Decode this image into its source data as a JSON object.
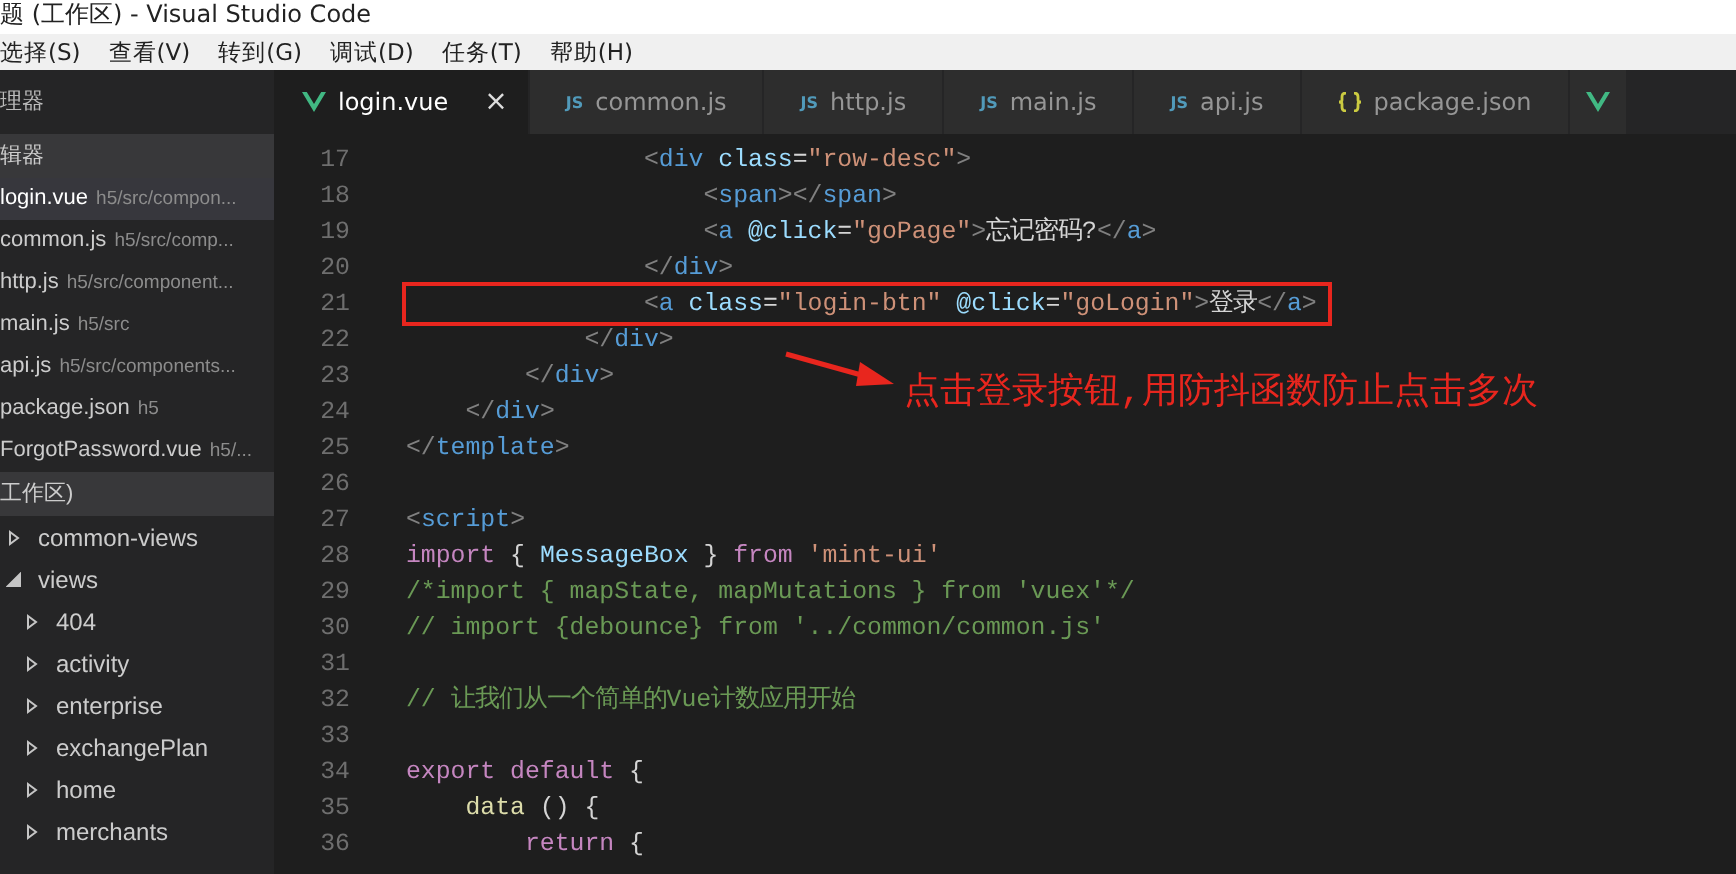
{
  "window": {
    "title": "题 (工作区) - Visual Studio Code"
  },
  "menu": [
    "选择(S)",
    "查看(V)",
    "转到(G)",
    "调试(D)",
    "任务(T)",
    "帮助(H)"
  ],
  "sidebar": {
    "title": "理器",
    "open_editors": {
      "title": "辑器",
      "items": [
        {
          "name": "login.vue",
          "path": "h5/src/compon...",
          "selected": true
        },
        {
          "name": "common.js",
          "path": "h5/src/comp...",
          "selected": false
        },
        {
          "name": "http.js",
          "path": "h5/src/component...",
          "selected": false
        },
        {
          "name": "main.js",
          "path": "h5/src",
          "selected": false
        },
        {
          "name": "api.js",
          "path": "h5/src/components...",
          "selected": false
        },
        {
          "name": "package.json",
          "path": "h5",
          "selected": false
        },
        {
          "name": "ForgotPassword.vue",
          "path": "h5/...",
          "selected": false
        }
      ]
    },
    "workspace": {
      "title": "工作区)",
      "items": [
        {
          "name": "common-views",
          "expanded": false
        },
        {
          "name": "views",
          "expanded": true,
          "children": [
            {
              "name": "404",
              "expanded": false
            },
            {
              "name": "activity",
              "expanded": false
            },
            {
              "name": "enterprise",
              "expanded": false
            },
            {
              "name": "exchangePlan",
              "expanded": false
            },
            {
              "name": "home",
              "expanded": false
            },
            {
              "name": "merchants",
              "expanded": false
            }
          ]
        }
      ]
    }
  },
  "tabs": [
    {
      "label": "login.vue",
      "kind": "vue",
      "selected": true,
      "close": "×"
    },
    {
      "label": "common.js",
      "kind": "js",
      "badge": "JS",
      "selected": false
    },
    {
      "label": "http.js",
      "kind": "js",
      "badge": "JS",
      "selected": false
    },
    {
      "label": "main.js",
      "kind": "js",
      "badge": "JS",
      "selected": false
    },
    {
      "label": "api.js",
      "kind": "js",
      "badge": "JS",
      "selected": false
    },
    {
      "label": "package.json",
      "kind": "json",
      "selected": false
    },
    {
      "kind": "vue",
      "selected": false
    }
  ],
  "code": [
    {
      "number": "17",
      "highlighted": false,
      "tokens": [
        {
          "kind": "punct",
          "text": "                <"
        },
        {
          "kind": "tag",
          "text": "div"
        },
        {
          "kind": "attr",
          "text": " class"
        },
        {
          "kind": "text",
          "text": "="
        },
        {
          "kind": "string",
          "text": "\"row-desc\""
        },
        {
          "kind": "punct",
          "text": ">"
        }
      ]
    },
    {
      "number": "18",
      "highlighted": false,
      "tokens": [
        {
          "kind": "punct",
          "text": "                    <"
        },
        {
          "kind": "tag",
          "text": "span"
        },
        {
          "kind": "punct",
          "text": "></"
        },
        {
          "kind": "tag",
          "text": "span"
        },
        {
          "kind": "punct",
          "text": ">"
        }
      ]
    },
    {
      "number": "19",
      "highlighted": false,
      "tokens": [
        {
          "kind": "punct",
          "text": "                    <"
        },
        {
          "kind": "tag",
          "text": "a"
        },
        {
          "kind": "attr",
          "text": " @click"
        },
        {
          "kind": "text",
          "text": "="
        },
        {
          "kind": "string",
          "text": "\"goPage\""
        },
        {
          "kind": "punct",
          "text": ">"
        },
        {
          "kind": "text",
          "text": "忘记密码?"
        },
        {
          "kind": "punct",
          "text": "</"
        },
        {
          "kind": "tag",
          "text": "a"
        },
        {
          "kind": "punct",
          "text": ">"
        }
      ]
    },
    {
      "number": "20",
      "highlighted": false,
      "tokens": [
        {
          "kind": "punct",
          "text": "                </"
        },
        {
          "kind": "tag",
          "text": "div"
        },
        {
          "kind": "punct",
          "text": ">"
        }
      ]
    },
    {
      "number": "21",
      "highlighted": true,
      "tokens": [
        {
          "kind": "punct",
          "text": "                <"
        },
        {
          "kind": "tag",
          "text": "a"
        },
        {
          "kind": "attr",
          "text": " class"
        },
        {
          "kind": "text",
          "text": "="
        },
        {
          "kind": "string",
          "text": "\"login-btn\""
        },
        {
          "kind": "attr",
          "text": " @click"
        },
        {
          "kind": "text",
          "text": "="
        },
        {
          "kind": "string",
          "text": "\"goLogin\""
        },
        {
          "kind": "punct",
          "text": ">"
        },
        {
          "kind": "text",
          "text": "登录"
        },
        {
          "kind": "punct",
          "text": "</"
        },
        {
          "kind": "tag",
          "text": "a"
        },
        {
          "kind": "punct",
          "text": ">"
        }
      ]
    },
    {
      "number": "22",
      "highlighted": false,
      "tokens": [
        {
          "kind": "punct",
          "text": "            </"
        },
        {
          "kind": "tag",
          "text": "div"
        },
        {
          "kind": "punct",
          "text": ">"
        }
      ]
    },
    {
      "number": "23",
      "highlighted": false,
      "tokens": [
        {
          "kind": "punct",
          "text": "        </"
        },
        {
          "kind": "tag",
          "text": "div"
        },
        {
          "kind": "punct",
          "text": ">"
        }
      ]
    },
    {
      "number": "24",
      "highlighted": false,
      "tokens": [
        {
          "kind": "punct",
          "text": "    </"
        },
        {
          "kind": "tag",
          "text": "div"
        },
        {
          "kind": "punct",
          "text": ">"
        }
      ]
    },
    {
      "number": "25",
      "highlighted": false,
      "tokens": [
        {
          "kind": "punct",
          "text": "</"
        },
        {
          "kind": "tag",
          "text": "template"
        },
        {
          "kind": "punct",
          "text": ">"
        }
      ]
    },
    {
      "number": "26",
      "highlighted": false
    },
    {
      "number": "27",
      "highlighted": false,
      "tokens": [
        {
          "kind": "punct",
          "text": "<"
        },
        {
          "kind": "tag",
          "text": "script"
        },
        {
          "kind": "punct",
          "text": ">"
        }
      ]
    },
    {
      "number": "28",
      "highlighted": false,
      "tokens": [
        {
          "kind": "keyword",
          "text": "import"
        },
        {
          "kind": "text",
          "text": " { "
        },
        {
          "kind": "attr",
          "text": "MessageBox"
        },
        {
          "kind": "text",
          "text": " } "
        },
        {
          "kind": "keyword",
          "text": "from"
        },
        {
          "kind": "string",
          "text": " 'mint-ui'"
        }
      ]
    },
    {
      "number": "29",
      "highlighted": false,
      "tokens": [
        {
          "kind": "comment",
          "text": "/*import { mapState, mapMutations } from 'vuex'*/"
        }
      ]
    },
    {
      "number": "30",
      "highlighted": false,
      "tokens": [
        {
          "kind": "comment",
          "text": "// import {debounce} from '../common/common.js'"
        }
      ]
    },
    {
      "number": "31",
      "highlighted": false
    },
    {
      "number": "32",
      "highlighted": false,
      "tokens": [
        {
          "kind": "comment",
          "text": "// 让我们从一个简单的Vue计数应用开始"
        }
      ]
    },
    {
      "number": "33",
      "highlighted": false
    },
    {
      "number": "34",
      "highlighted": false,
      "tokens": [
        {
          "kind": "keyword",
          "text": "export"
        },
        {
          "kind": "keyword",
          "text": " default"
        },
        {
          "kind": "text",
          "text": " {"
        }
      ]
    },
    {
      "number": "35",
      "highlighted": false,
      "tokens": [
        {
          "kind": "function",
          "text": "    data"
        },
        {
          "kind": "text",
          "text": " () {"
        }
      ]
    },
    {
      "number": "36",
      "highlighted": false,
      "tokens": [
        {
          "kind": "keyword",
          "text": "        return"
        },
        {
          "kind": "text",
          "text": " {"
        }
      ]
    }
  ],
  "annotation": {
    "text": "点击登录按钮,用防抖函数防止点击多次"
  }
}
